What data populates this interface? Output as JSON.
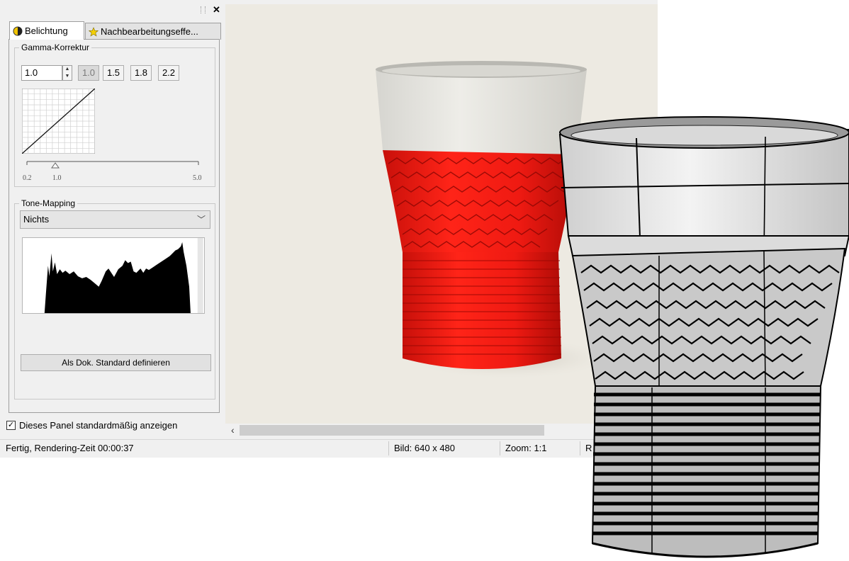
{
  "panel": {
    "tabs": [
      {
        "label": "Belichtung",
        "icon": "exposure-icon"
      },
      {
        "label": "Nachbearbeitungseffe...",
        "icon": "star-icon"
      }
    ],
    "gamma": {
      "legend": "Gamma-Korrektur",
      "value": "1.0",
      "presets": [
        "1.0",
        "1.5",
        "1.8",
        "2.2"
      ],
      "slider": {
        "min_label": "0.2",
        "current_label": "1.0",
        "max_label": "5.0",
        "value": 1.0
      }
    },
    "tone_mapping": {
      "legend": "Tone-Mapping",
      "selected": "Nichts"
    },
    "default_button": "Als Dok. Standard definieren",
    "show_default_checkbox": {
      "label": "Dieses Panel standardmäßig anzeigen",
      "checked": true
    }
  },
  "status": {
    "message": "Fertig, Rendering-Zeit 00:00:37",
    "image_size": "Bild: 640 x 480",
    "zoom": "Zoom: 1:1",
    "truncated": "R"
  },
  "colors": {
    "cup_red": "#ff1a10",
    "cup_white": "#e9e8e3",
    "viewport_bg": "#edeae2",
    "panel_bg": "#f0f0f0"
  }
}
